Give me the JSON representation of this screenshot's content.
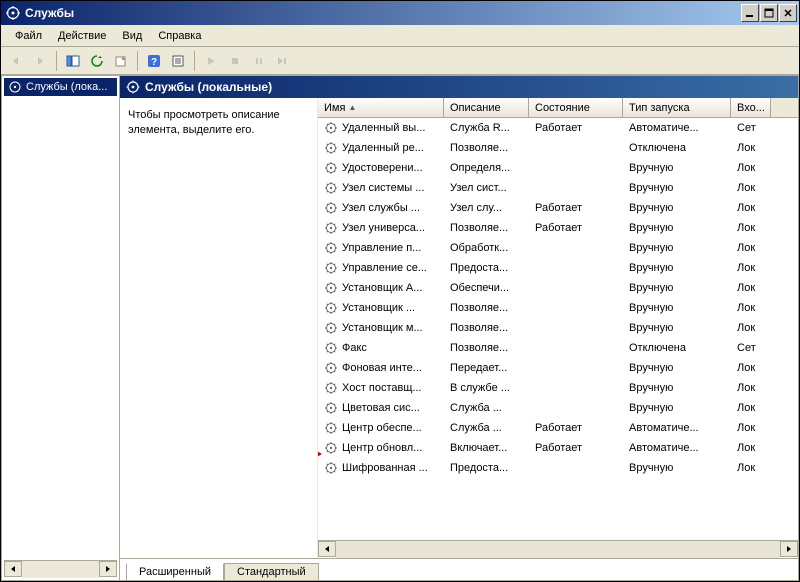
{
  "window": {
    "title": "Службы"
  },
  "menu": {
    "file": "Файл",
    "action": "Действие",
    "view": "Вид",
    "help": "Справка"
  },
  "tree": {
    "root": "Службы (лока..."
  },
  "pane": {
    "title": "Службы (локальные)",
    "hint": "Чтобы просмотреть описание элемента, выделите его."
  },
  "columns": {
    "name": "Имя",
    "description": "Описание",
    "status": "Состояние",
    "startup_type": "Тип запуска",
    "logon_as": "Вхо..."
  },
  "services": [
    {
      "name": "Удаленный вы...",
      "desc": "Служба R...",
      "state": "Работает",
      "start": "Автоматиче...",
      "logon": "Сет"
    },
    {
      "name": "Удаленный ре...",
      "desc": "Позволяе...",
      "state": "",
      "start": "Отключена",
      "logon": "Лок"
    },
    {
      "name": "Удостоверени...",
      "desc": "Определя...",
      "state": "",
      "start": "Вручную",
      "logon": "Лок"
    },
    {
      "name": "Узел системы ...",
      "desc": "Узел сист...",
      "state": "",
      "start": "Вручную",
      "logon": "Лок"
    },
    {
      "name": "Узел службы ...",
      "desc": "Узел слу...",
      "state": "Работает",
      "start": "Вручную",
      "logon": "Лок"
    },
    {
      "name": "Узел универса...",
      "desc": "Позволяе...",
      "state": "Работает",
      "start": "Вручную",
      "logon": "Лок"
    },
    {
      "name": "Управление п...",
      "desc": "Обработк...",
      "state": "",
      "start": "Вручную",
      "logon": "Лок"
    },
    {
      "name": "Управление се...",
      "desc": "Предоста...",
      "state": "",
      "start": "Вручную",
      "logon": "Лок"
    },
    {
      "name": "Установщик A...",
      "desc": "Обеспечи...",
      "state": "",
      "start": "Вручную",
      "logon": "Лок"
    },
    {
      "name": "Установщик ...",
      "desc": "Позволяе...",
      "state": "",
      "start": "Вручную",
      "logon": "Лок"
    },
    {
      "name": "Установщик м...",
      "desc": "Позволяе...",
      "state": "",
      "start": "Вручную",
      "logon": "Лок"
    },
    {
      "name": "Факс",
      "desc": "Позволяе...",
      "state": "",
      "start": "Отключена",
      "logon": "Сет"
    },
    {
      "name": "Фоновая инте...",
      "desc": "Передает...",
      "state": "",
      "start": "Вручную",
      "logon": "Лок"
    },
    {
      "name": "Хост поставщ...",
      "desc": "В службе ...",
      "state": "",
      "start": "Вручную",
      "logon": "Лок"
    },
    {
      "name": "Цветовая сис...",
      "desc": "Служба ...",
      "state": "",
      "start": "Вручную",
      "logon": "Лок"
    },
    {
      "name": "Центр обеспе...",
      "desc": "Служба ...",
      "state": "Работает",
      "start": "Автоматиче...",
      "logon": "Лок"
    },
    {
      "name": "Центр обновл...",
      "desc": "Включает...",
      "state": "Работает",
      "start": "Автоматиче...",
      "logon": "Лок"
    },
    {
      "name": "Шифрованная ...",
      "desc": "Предоста...",
      "state": "",
      "start": "Вручную",
      "logon": "Лок"
    }
  ],
  "tabs": {
    "extended": "Расширенный",
    "standard": "Стандартный"
  }
}
